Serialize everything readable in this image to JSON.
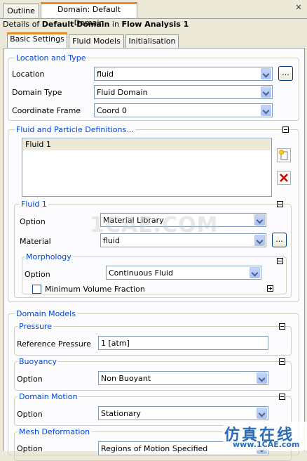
{
  "tabs": {
    "outline": "Outline",
    "domain": "Domain: Default Domain"
  },
  "details": {
    "prefix": "Details of ",
    "object": "Default Domain",
    "middle": " in ",
    "analysis": "Flow Analysis 1"
  },
  "subtabs": {
    "basic": "Basic Settings",
    "fluid_models": "Fluid Models",
    "initialisation": "Initialisation"
  },
  "location_type": {
    "title": "Location and Type",
    "location_label": "Location",
    "location_value": "fluid",
    "domain_type_label": "Domain Type",
    "domain_type_value": "Fluid Domain",
    "coord_label": "Coordinate Frame",
    "coord_value": "Coord 0",
    "dots": "..."
  },
  "fluid_defs": {
    "title": "Fluid and Particle Definitions...",
    "items": [
      "Fluid 1"
    ]
  },
  "fluid1": {
    "title": "Fluid 1",
    "option_label": "Option",
    "option_value": "Material Library",
    "material_label": "Material",
    "material_value": "fluid",
    "dots": "...",
    "morphology": {
      "title": "Morphology",
      "option_label": "Option",
      "option_value": "Continuous Fluid",
      "min_vol_label": "Minimum Volume Fraction"
    }
  },
  "domain_models": {
    "title": "Domain Models",
    "pressure": {
      "title": "Pressure",
      "ref_label": "Reference Pressure",
      "ref_value": "1 [atm]"
    },
    "buoyancy": {
      "title": "Buoyancy",
      "option_label": "Option",
      "option_value": "Non Buoyant"
    },
    "domain_motion": {
      "title": "Domain Motion",
      "option_label": "Option",
      "option_value": "Stationary"
    },
    "mesh_deformation": {
      "title": "Mesh Deformation",
      "option_label": "Option",
      "option_value": "Regions of Motion Specified"
    }
  },
  "watermark": "1CAE.COM",
  "brand": {
    "chinese": "仿真在线",
    "url": "www.1CAE.com"
  }
}
